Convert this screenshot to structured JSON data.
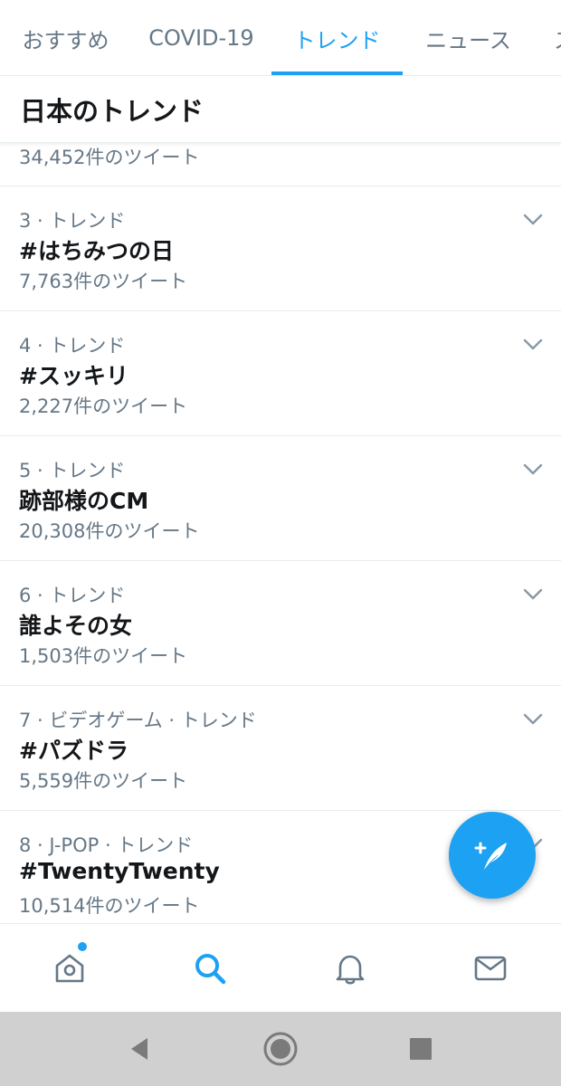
{
  "tabs": [
    {
      "label": "おすすめ",
      "active": false
    },
    {
      "label": "COVID-19",
      "active": false
    },
    {
      "label": "トレンド",
      "active": true
    },
    {
      "label": "ニュース",
      "active": false
    },
    {
      "label": "ス",
      "active": false
    }
  ],
  "section_title": "日本のトレンド",
  "partial_item": {
    "count": "34,452件のツイート"
  },
  "trends": [
    {
      "meta": "3 · トレンド",
      "name": "#はちみつの日",
      "count": "7,763件のツイート"
    },
    {
      "meta": "4 · トレンド",
      "name": "#スッキリ",
      "count": "2,227件のツイート"
    },
    {
      "meta": "5 · トレンド",
      "name": "跡部様のCM",
      "count": "20,308件のツイート"
    },
    {
      "meta": "6 · トレンド",
      "name": "誰よその女",
      "count": "1,503件のツイート"
    },
    {
      "meta": "7 · ビデオゲーム · トレンド",
      "name": "#パズドラ",
      "count": "5,559件のツイート"
    },
    {
      "meta": "8 · J-POP · トレンド",
      "name": "#TwentyTwenty",
      "count": "10,514件のツイート"
    }
  ],
  "icons": {
    "trend_menu": "chevron-down-icon",
    "compose": "compose-tweet-icon",
    "nav": [
      "home-icon",
      "search-icon",
      "bell-icon",
      "mail-icon"
    ],
    "system": [
      "back-icon",
      "home-circle-icon",
      "recents-icon"
    ]
  },
  "colors": {
    "accent": "#1da1f2",
    "text_primary": "#14171a",
    "text_secondary": "#657786",
    "divider": "#e6ecf0"
  },
  "nav_active": "search",
  "home_unread_indicator": true
}
